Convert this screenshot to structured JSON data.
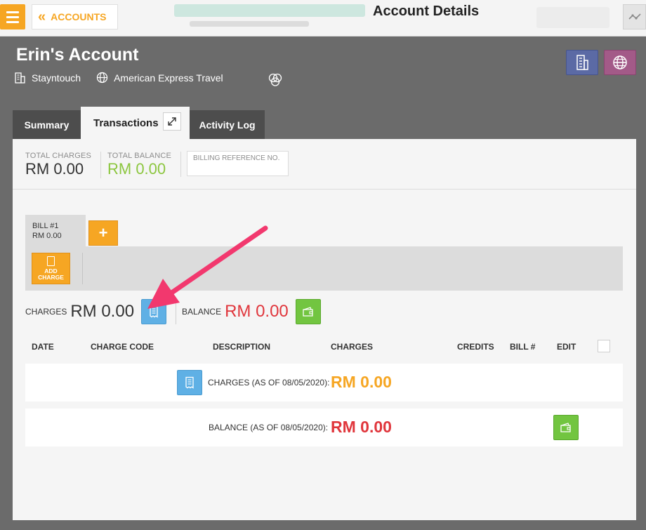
{
  "topbar": {
    "back_label": "ACCOUNTS",
    "title": "Account Details"
  },
  "account": {
    "name": "Erin's Account",
    "company": "Stayntouch",
    "travel_agent": "American Express Travel"
  },
  "tabs": [
    {
      "label": "Summary"
    },
    {
      "label": "Transactions"
    },
    {
      "label": "Activity Log"
    }
  ],
  "totals": {
    "total_charges_label": "TOTAL CHARGES",
    "total_charges_value": "RM 0.00",
    "total_balance_label": "TOTAL BALANCE",
    "total_balance_value": "RM 0.00",
    "billing_ref_placeholder": "BILLING REFERENCE NO."
  },
  "bill": {
    "name": "BILL #1",
    "amount": "RM 0.00",
    "add_bill_symbol": "+",
    "add_charge_line1": "ADD",
    "add_charge_line2": "CHARGE"
  },
  "summary": {
    "charges_label": "CHARGES",
    "charges_value": "RM 0.00",
    "balance_label": "BALANCE",
    "balance_value": "RM 0.00"
  },
  "table": {
    "columns": [
      "DATE",
      "CHARGE CODE",
      "DESCRIPTION",
      "CHARGES",
      "CREDITS",
      "BILL #",
      "EDIT"
    ],
    "rows": [
      {
        "label": "CHARGES (AS OF 08/05/2020):",
        "amount": "RM 0.00"
      },
      {
        "label": "BALANCE (AS OF 08/05/2020):",
        "amount": "RM 0.00"
      }
    ]
  },
  "icons": {
    "menu": "hamburger-icon",
    "back": "double-chevron-left-icon",
    "activity": "activity-graph-icon",
    "company": "building-icon",
    "travel_agent": "globe-icon",
    "group": "venn-icon",
    "expand": "expand-icon",
    "receipt": "receipt-icon",
    "wallet": "wallet-icon",
    "add_charge": "calculator-icon"
  },
  "colors": {
    "accent_orange": "#f6a623",
    "receipt_blue": "#5fb0e5",
    "wallet_green": "#72c540",
    "balance_red": "#e0363c",
    "balance_green": "#8cc63f",
    "annotation_pink": "#f2386e"
  }
}
